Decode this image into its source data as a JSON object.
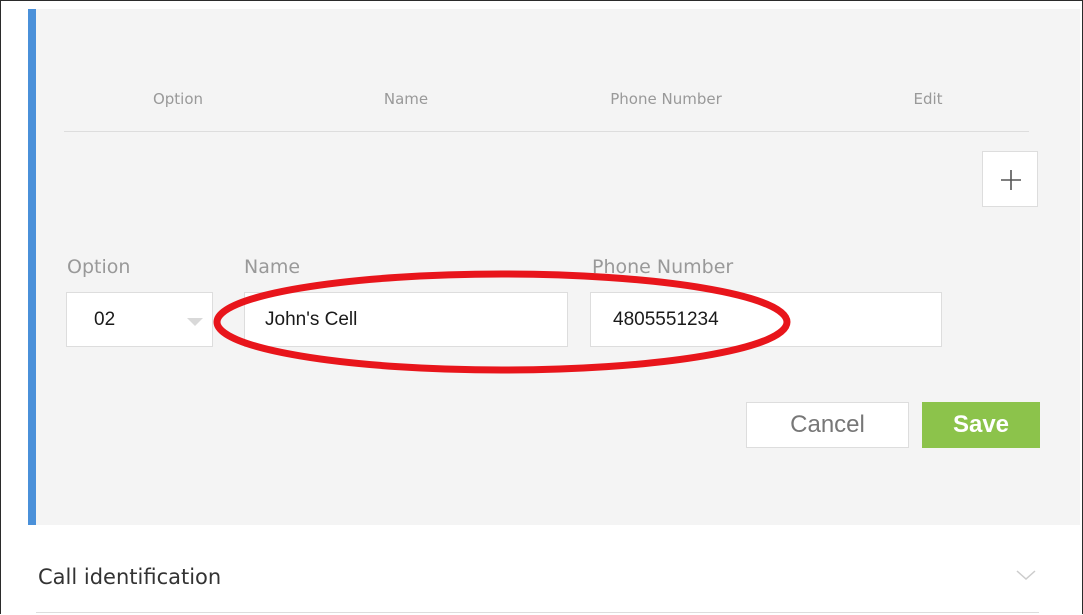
{
  "table": {
    "headers": {
      "option": "Option",
      "name": "Name",
      "phone": "Phone Number",
      "edit": "Edit"
    }
  },
  "form": {
    "option_label": "Option",
    "option_value": "02",
    "name_label": "Name",
    "name_value": "John's Cell",
    "phone_label": "Phone Number",
    "phone_value": "4805551234"
  },
  "buttons": {
    "cancel": "Cancel",
    "save": "Save"
  },
  "sections": {
    "call_identification": "Call identification"
  },
  "colors": {
    "accent_bar": "#4a90d9",
    "save_button": "#8cc34b",
    "highlight_ellipse": "#e8151b"
  },
  "icons": {
    "add": "plus-icon",
    "option_dropdown": "caret-down-icon",
    "section_toggle": "chevron-down-icon"
  }
}
